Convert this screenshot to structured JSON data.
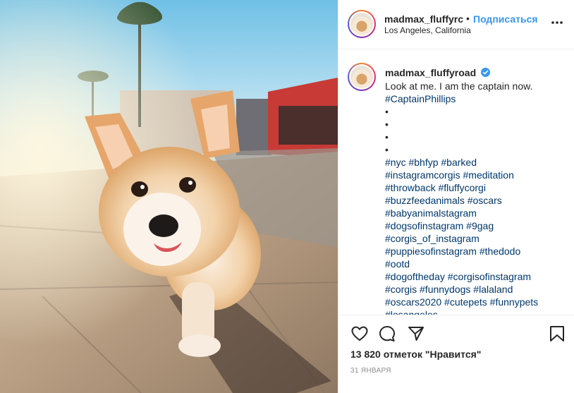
{
  "post": {
    "image_alt": "corgi",
    "header": {
      "username": "madmax_fluffyroad",
      "username_truncated": "madmax_fluffyrc",
      "separator": "•",
      "follow_label": "Подписаться",
      "location": "Los Angeles, California",
      "more_icon": "more-horizontal-icon"
    },
    "caption": {
      "username": "madmax_fluffyroad",
      "verified_icon": "verified-badge-icon",
      "lines": [
        {
          "text": "Look at me. I am the captain now.",
          "kind": "plain"
        },
        {
          "text": "#CaptainPhillips",
          "kind": "tag"
        },
        {
          "text": "•",
          "kind": "plain"
        },
        {
          "text": "•",
          "kind": "plain"
        },
        {
          "text": "•",
          "kind": "plain"
        },
        {
          "text": "•",
          "kind": "plain"
        },
        {
          "text": "#nyc #bhfyp #barked",
          "kind": "tag"
        },
        {
          "text": "#instagramcorgis #meditation",
          "kind": "tag"
        },
        {
          "text": "#throwback #fluffycorgi",
          "kind": "tag"
        },
        {
          "text": "#buzzfeedanimals #oscars",
          "kind": "tag"
        },
        {
          "text": "#babyanimalstagram",
          "kind": "tag"
        },
        {
          "text": "#dogsofinstagram #9gag",
          "kind": "tag"
        },
        {
          "text": "#corgis_of_instagram",
          "kind": "tag"
        },
        {
          "text": "#puppiesofinstagram #thedodo",
          "kind": "tag"
        },
        {
          "text": "#ootd",
          "kind": "tag"
        },
        {
          "text": "#dogoftheday #corgisofinstagram",
          "kind": "tag"
        },
        {
          "text": "#corgis #funnydogs #lalaland",
          "kind": "tag"
        },
        {
          "text": "#oscars2020 #cutepets #funnypets",
          "kind": "tag"
        },
        {
          "text": "#losangeles",
          "kind": "tag"
        }
      ]
    },
    "actions": {
      "like_icon": "heart-icon",
      "comment_icon": "comment-icon",
      "share_icon": "share-icon",
      "save_icon": "bookmark-icon"
    },
    "likes_text": "13 820 отметок \"Нравится\"",
    "date_text": "31 ЯНВАРЯ",
    "colors": {
      "link": "#3897f0",
      "hashtag": "#00376b",
      "text": "#262626",
      "muted": "#8e8e8e",
      "verified": "#3897f0"
    }
  }
}
